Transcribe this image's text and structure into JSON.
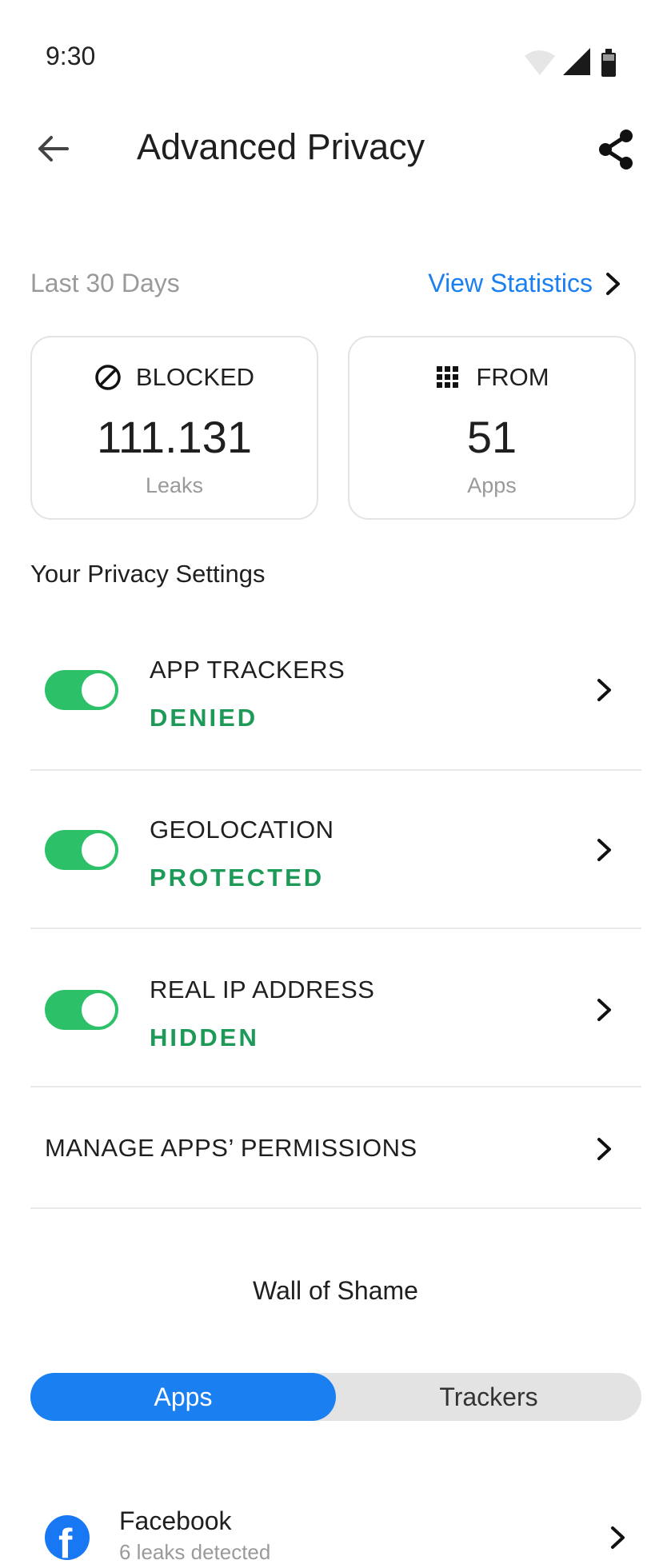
{
  "status_bar": {
    "time": "9:30"
  },
  "header": {
    "title": "Advanced Privacy"
  },
  "period": {
    "label": "Last 30 Days",
    "view_statistics": "View Statistics"
  },
  "cards": {
    "blocked": {
      "heading": "BLOCKED",
      "value": "111.131",
      "unit": "Leaks"
    },
    "from": {
      "heading": "FROM",
      "value": "51",
      "unit": "Apps"
    }
  },
  "settings": {
    "title": "Your Privacy Settings",
    "items": [
      {
        "label": "APP TRACKERS",
        "status": "DENIED",
        "enabled": true
      },
      {
        "label": "GEOLOCATION",
        "status": "PROTECTED",
        "enabled": true
      },
      {
        "label": "REAL IP ADDRESS",
        "status": "HIDDEN",
        "enabled": true
      }
    ],
    "manage": "MANAGE APPS’ PERMISSIONS"
  },
  "wall": {
    "title": "Wall of Shame",
    "tabs": [
      {
        "label": "Apps",
        "active": true
      },
      {
        "label": "Trackers",
        "active": false
      }
    ],
    "apps": [
      {
        "name": "Facebook",
        "detail": "6 leaks detected",
        "icon": "facebook-icon"
      }
    ]
  },
  "colors": {
    "accent": "#1a7ff0",
    "toggle_on": "#2cc168",
    "status_green": "#1e9a58"
  }
}
